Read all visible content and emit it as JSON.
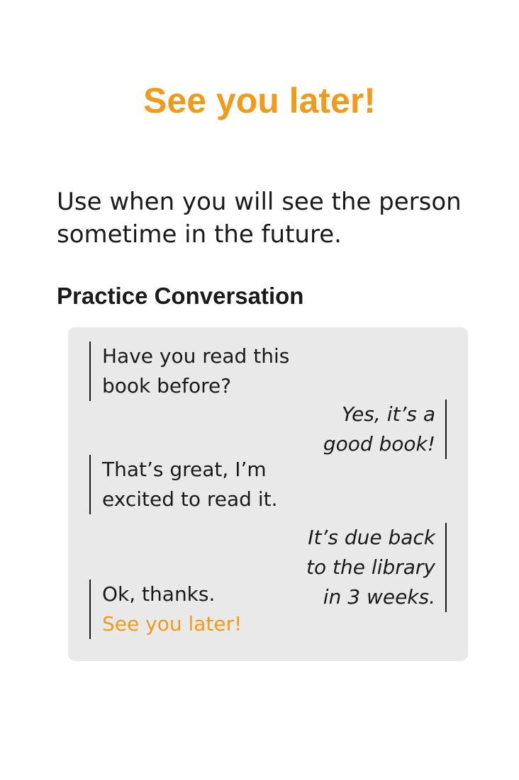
{
  "title": "See you later!",
  "description": "Use when you will see the person sometime in the future.",
  "section_heading": "Practice Conversation",
  "conversation": [
    {
      "speaker": "left",
      "lines": [
        "Have you read this",
        "book before?"
      ]
    },
    {
      "speaker": "right",
      "lines": [
        "Yes, it’s a",
        "good book!"
      ]
    },
    {
      "speaker": "left",
      "lines": [
        "That’s great, I’m",
        "excited to read it."
      ]
    },
    {
      "speaker": "right",
      "lines": [
        "It’s due back",
        "to the library",
        "in 3 weeks."
      ]
    },
    {
      "speaker": "left",
      "lines": [
        "Ok, thanks.",
        "See you later!"
      ]
    }
  ],
  "colors": {
    "accent": "#f29a1a",
    "box": "#e9e9e9",
    "text": "#1a1a1a"
  }
}
